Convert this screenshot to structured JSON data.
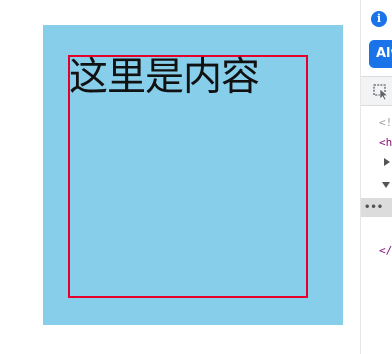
{
  "preview": {
    "content_text": "这里是内容"
  },
  "devtools": {
    "info_icon": "i",
    "always_button_label": "Alw",
    "inspect_icon": "inspect-element-icon",
    "code_lines": {
      "doctype": "<!",
      "html_open": "<h",
      "html_close": "</"
    },
    "selected_row_ellipsis": "•••"
  },
  "colors": {
    "outer_box_background": "#87ceeb",
    "inner_box_border": "#e4002b",
    "devtools_accent": "#1a73e8"
  }
}
